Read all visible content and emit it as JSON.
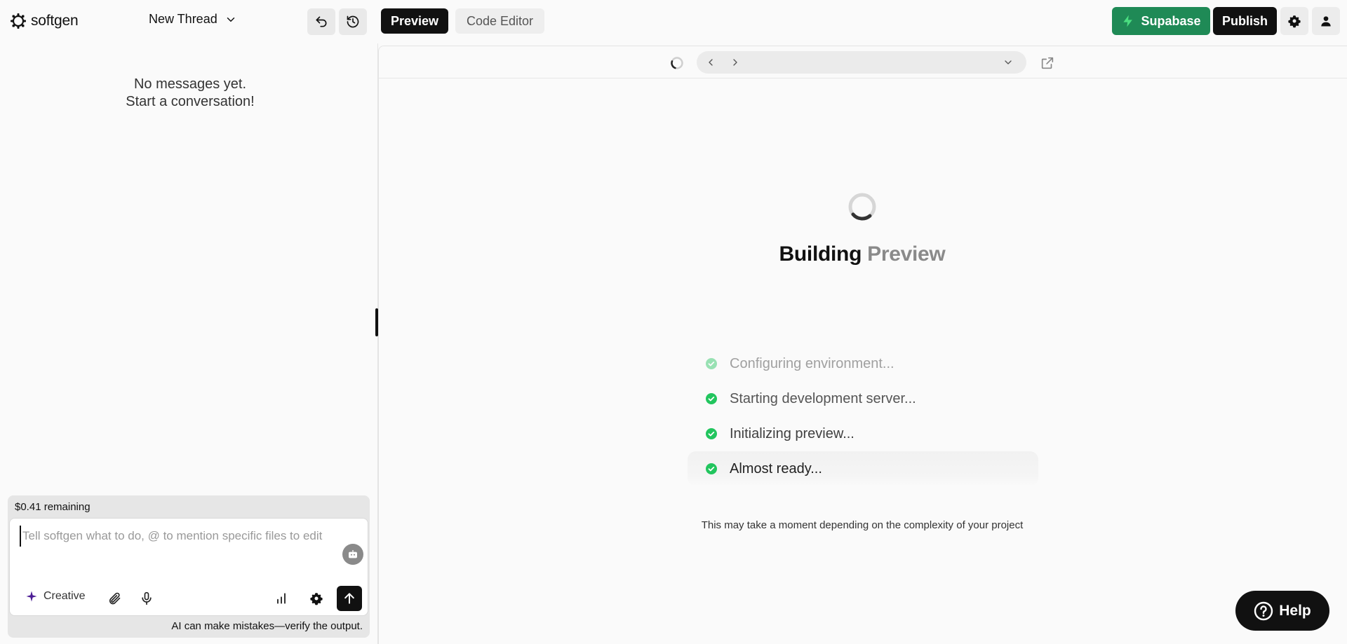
{
  "header": {
    "logo_text": "softgen",
    "thread_title": "New Thread",
    "tabs": [
      {
        "label": "Preview",
        "active": true
      },
      {
        "label": "Code Editor",
        "active": false
      }
    ],
    "supabase_label": "Supabase",
    "publish_label": "Publish",
    "icons": {
      "undo": "undo-icon",
      "history": "history-icon",
      "settings": "gear-icon",
      "user": "user-icon",
      "supabase": "lightning-icon"
    }
  },
  "chat": {
    "empty_line1": "No messages yet.",
    "empty_line2": "Start a conversation!",
    "remaining": "$0.41 remaining",
    "input_placeholder": "Tell softgen what to do, @ to mention specific files to edit",
    "input_value": "",
    "mode_label": "Creative",
    "disclaimer": "AI can make mistakes—verify the output."
  },
  "preview": {
    "url": "",
    "title_main": "Building",
    "title_faded": "Preview",
    "steps": [
      {
        "label": "Configuring environment...",
        "state": "done"
      },
      {
        "label": "Starting development server...",
        "state": "done"
      },
      {
        "label": "Initializing preview...",
        "state": "done"
      },
      {
        "label": "Almost ready...",
        "state": "current"
      }
    ],
    "hint": "This may take a moment depending on the complexity of your project"
  },
  "help_label": "Help",
  "colors": {
    "accent_dark": "#111111",
    "supabase_green": "#1f8a56",
    "check_green": "#22c55e",
    "creative_purple": "#6d28d9"
  }
}
